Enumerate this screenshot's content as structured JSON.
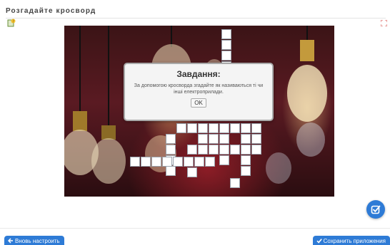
{
  "header": {
    "title": "Розгадайте кросворд"
  },
  "icons": {
    "help": "help-icon",
    "fullscreen": "fullscreen-icon",
    "check": "check-icon",
    "back_arrow": "arrow-left-icon",
    "save_check": "checkmark-icon"
  },
  "dialog": {
    "title": "Завдання:",
    "text": "За допомогою кросворда згадайте як називаються ті чи інші електроприлади.",
    "ok_label": "OK"
  },
  "footer": {
    "back_label": "Вновь настроить",
    "save_label": "Сохранить приложения"
  },
  "colors": {
    "accent": "#2e7bd6",
    "background_image_tone": "#5a1a22"
  }
}
